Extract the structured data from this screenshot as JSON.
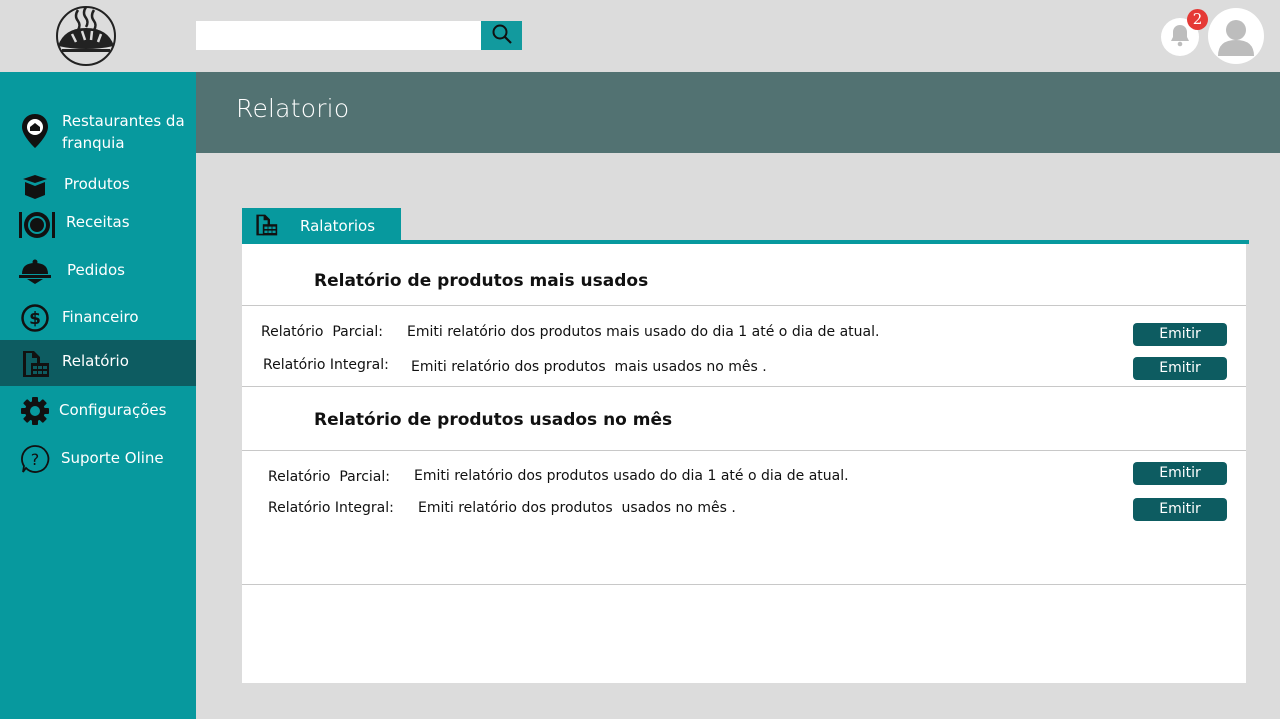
{
  "colors": {
    "accent": "#07999e",
    "accent_dark": "#0d5c61",
    "header": "#527272",
    "badge": "#e53935",
    "background": "#dcdcdc"
  },
  "topbar": {
    "logo": "bakery-bread-logo",
    "search": {
      "value": "",
      "placeholder": "",
      "button_icon": "search-icon"
    },
    "notifications": {
      "icon": "bell-icon",
      "count": "2"
    },
    "avatar_icon": "user-avatar-icon"
  },
  "sidebar": {
    "items": [
      {
        "label_line1": "Restaurantes da",
        "label_line2": "franquia",
        "icon": "store-location-icon"
      },
      {
        "label": "Produtos",
        "icon": "box-icon"
      },
      {
        "label": "Receitas",
        "icon": "plate-cutlery-icon"
      },
      {
        "label": "Pedidos",
        "icon": "cloche-icon"
      },
      {
        "label": "Financeiro",
        "icon": "dollar-coin-icon"
      },
      {
        "label": "Relatório",
        "icon": "report-icon",
        "active": true
      },
      {
        "label": "Configurações",
        "icon": "gear-icon"
      },
      {
        "label": "Suporte Oline",
        "icon": "help-icon"
      }
    ]
  },
  "header": {
    "title": "Relatorio"
  },
  "tab": {
    "label": "Ralatorios",
    "icon": "report-icon"
  },
  "sections": [
    {
      "title": "Relatório de produtos mais  usados",
      "rows": [
        {
          "label": "Relatório  Parcial:",
          "description": "Emiti relatório dos produtos mais usado do dia 1 até o dia de atual.",
          "button": "Emitir"
        },
        {
          "label": "Relatório Integral:",
          "description": "Emiti relatório dos produtos  mais usados no mês .",
          "button": "Emitir"
        }
      ]
    },
    {
      "title": "Relatório de produtos  usados no mês",
      "rows": [
        {
          "label": "Relatório  Parcial:",
          "description": "Emiti relatório dos produtos usado do dia 1 até o dia de atual.",
          "button": "Emitir"
        },
        {
          "label": "Relatório Integral:",
          "description": "Emiti relatório dos produtos  usados no mês .",
          "button": "Emitir"
        }
      ]
    }
  ]
}
